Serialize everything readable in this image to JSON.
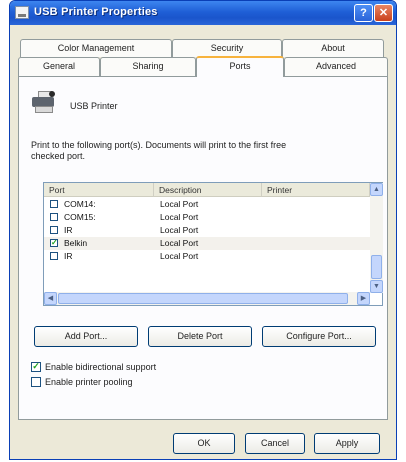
{
  "window": {
    "title": "USB Printer Properties",
    "help_label": "?",
    "close_label": "✕"
  },
  "tabs": {
    "row1": [
      "Color Management",
      "Security",
      "About"
    ],
    "row2": [
      "General",
      "Sharing",
      "Ports",
      "Advanced"
    ],
    "active": "Ports"
  },
  "printer_name": "USB Printer",
  "instructions": {
    "line1": "Print to the following port(s). Documents will print to the first free",
    "line2": "checked port."
  },
  "ports_table": {
    "columns": [
      "Port",
      "Description",
      "Printer"
    ],
    "rows": [
      {
        "port": "COM14:",
        "description": "Local Port",
        "printer": "",
        "checked": false
      },
      {
        "port": "COM15:",
        "description": "Local Port",
        "printer": "",
        "checked": false
      },
      {
        "port": "IR",
        "description": "Local Port",
        "printer": "",
        "checked": false
      },
      {
        "port": "Belkin",
        "description": "Local Port",
        "printer": "",
        "checked": true,
        "selected": true
      },
      {
        "port": "IR",
        "description": "Local Port",
        "printer": "",
        "checked": false
      }
    ]
  },
  "port_buttons": {
    "add": "Add Port...",
    "delete": "Delete Port",
    "configure": "Configure Port..."
  },
  "options": {
    "bidirectional_label": "Enable bidirectional support",
    "bidirectional_checked": true,
    "pooling_label": "Enable printer pooling",
    "pooling_checked": false
  },
  "dialog_buttons": {
    "ok": "OK",
    "cancel": "Cancel",
    "apply": "Apply"
  },
  "colors": {
    "titlebar": "#1f5fd6",
    "window_face": "#ece9d8",
    "active_tab_accent": "#f7b33d",
    "check_green": "#21a121"
  }
}
